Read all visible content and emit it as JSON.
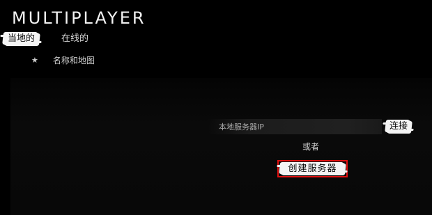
{
  "header": {
    "title": "MULTIPLAYER"
  },
  "tabs": [
    {
      "label": "当地的",
      "active": true
    },
    {
      "label": "在线的",
      "active": false
    }
  ],
  "server_list": {
    "favorite_icon": "star-icon",
    "column_label": "名称和地图"
  },
  "connect": {
    "ip_placeholder": "本地服务器IP",
    "ip_value": "",
    "connect_label": "连接",
    "or_label": "或者",
    "create_server_label": "创建服务器"
  },
  "colors": {
    "background": "#000000",
    "highlight_brush": "#f4f4f4",
    "focus_outline": "#e01010",
    "text": "#e6e6e6"
  }
}
